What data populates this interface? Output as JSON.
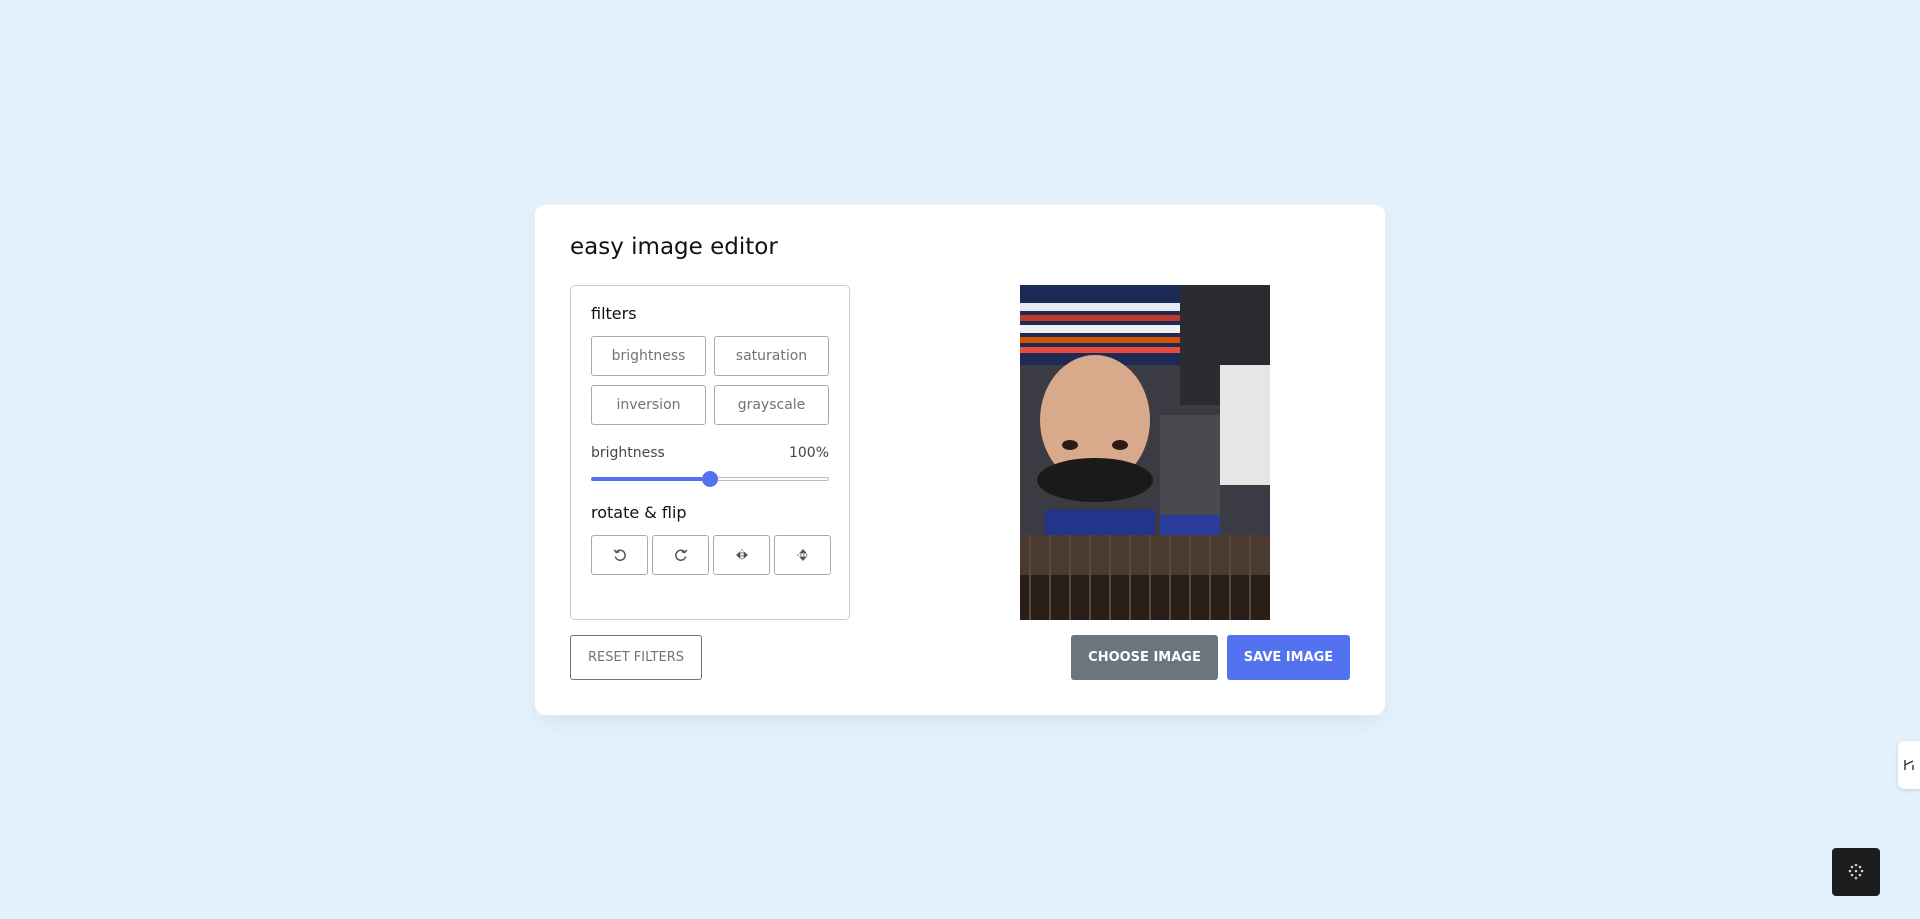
{
  "app": {
    "title": "easy image editor"
  },
  "filters": {
    "section_label": "filters",
    "options": [
      {
        "label": "brightness",
        "icon": ""
      },
      {
        "label": "saturation",
        "icon": ""
      },
      {
        "label": "inversion",
        "icon": ""
      },
      {
        "label": "grayscale",
        "icon": ""
      }
    ],
    "active_option": "brightness"
  },
  "slider": {
    "name": "brightness",
    "value_text": "100%",
    "value_fraction": 0.5
  },
  "rotate": {
    "section_label": "rotate & flip",
    "buttons": [
      {
        "icon": "rotate-left-icon"
      },
      {
        "icon": "rotate-right-icon"
      },
      {
        "icon": "flip-horizontal-icon"
      },
      {
        "icon": "flip-vertical-icon"
      }
    ]
  },
  "actions": {
    "reset_label": "Reset Filters",
    "choose_label": "CHOOSE IMAGE",
    "save_label": "SAVE IMAGE"
  },
  "colors": {
    "background": "#e3f2fd",
    "accent": "#5372f0",
    "secondary": "#6c757d"
  }
}
